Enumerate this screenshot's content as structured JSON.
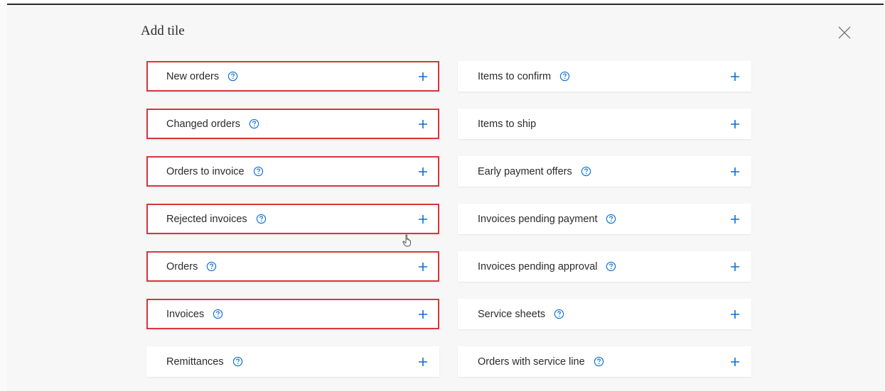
{
  "dialog": {
    "title": "Add tile",
    "close_icon": "close-icon",
    "accent_color": "#0a6ed1",
    "highlight_color": "#d9363e"
  },
  "tiles_left": [
    {
      "label": "New orders",
      "help": true,
      "highlighted": true
    },
    {
      "label": "Changed orders",
      "help": true,
      "highlighted": true
    },
    {
      "label": "Orders to invoice",
      "help": true,
      "highlighted": true
    },
    {
      "label": "Rejected invoices",
      "help": true,
      "highlighted": true
    },
    {
      "label": "Orders",
      "help": true,
      "highlighted": true
    },
    {
      "label": "Invoices",
      "help": true,
      "highlighted": true
    },
    {
      "label": "Remittances",
      "help": true,
      "highlighted": false
    }
  ],
  "tiles_right": [
    {
      "label": "Items to confirm",
      "help": true,
      "highlighted": false
    },
    {
      "label": "Items to ship",
      "help": false,
      "highlighted": false
    },
    {
      "label": "Early payment offers",
      "help": true,
      "highlighted": false
    },
    {
      "label": "Invoices pending payment",
      "help": true,
      "highlighted": false
    },
    {
      "label": "Invoices pending approval",
      "help": true,
      "highlighted": false
    },
    {
      "label": "Service sheets",
      "help": true,
      "highlighted": false
    },
    {
      "label": "Orders with service line",
      "help": true,
      "highlighted": false
    }
  ]
}
